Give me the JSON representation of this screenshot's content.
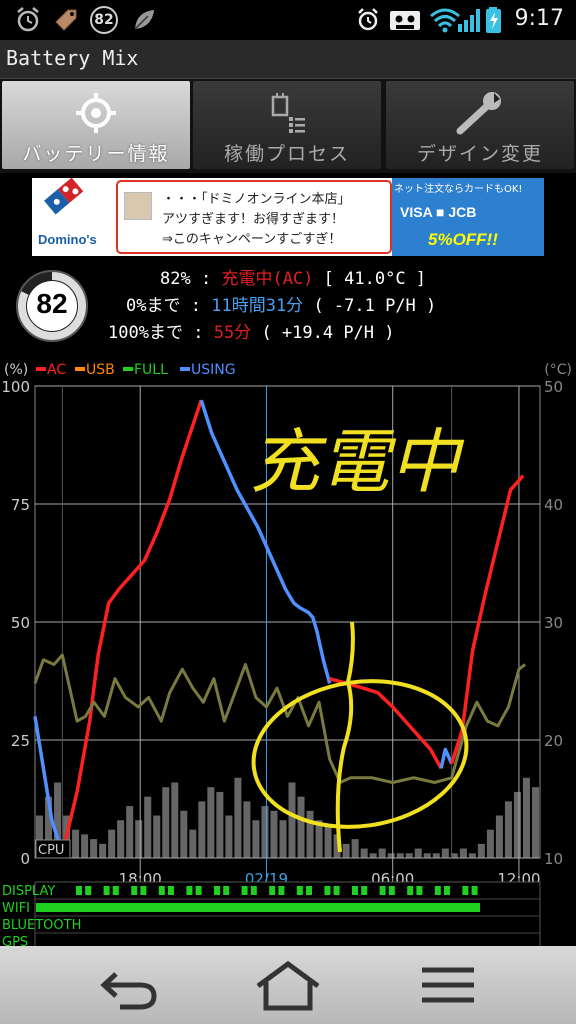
{
  "status_bar": {
    "time": "9:17",
    "battery_badge": "82",
    "icons_left": [
      "alarm-icon",
      "tag-icon",
      "battery-mix-badge-icon",
      "leaf-icon"
    ],
    "icons_right": [
      "alarm-icon",
      "cassette-icon",
      "wifi-icon",
      "signal-icon",
      "battery-charging-icon"
    ]
  },
  "app": {
    "title": "Battery Mix"
  },
  "tabs": [
    {
      "label": "バッテリー情報",
      "icon": "crosshair-icon",
      "selected": true
    },
    {
      "label": "稼働プロセス",
      "icon": "process-list-icon",
      "selected": false
    },
    {
      "label": "デザイン変更",
      "icon": "wrench-icon",
      "selected": false
    }
  ],
  "ad": {
    "brand": "Domino's",
    "line1": "・・・「ドミノオンライン本店」",
    "line2": "アツすぎます！お得すぎます！",
    "line3": "⇒このキャンペーンすごすぎ！",
    "right_top": "ネット注文ならカードもOK!",
    "right_cards": "VISA ■ JCB",
    "right_offer": "5%OFF!!"
  },
  "battery": {
    "level": "82",
    "row1": {
      "pct": "82%",
      "colon": ":",
      "status": "充電中(AC)",
      "temp": "[ 41.0°C ]"
    },
    "row2": {
      "label": "0%まで",
      "colon": ":",
      "time": "11時間31分",
      "rate": "( -7.1 P/H )"
    },
    "row3": {
      "label": "100%まで",
      "colon": ":",
      "time": "55分",
      "rate": "( +19.4 P/H )"
    }
  },
  "chart_data": {
    "type": "line",
    "left_axis_unit": "(%)",
    "right_axis_unit": "(°C)",
    "legend": [
      {
        "name": "AC",
        "color": "#ff2020"
      },
      {
        "name": "USB",
        "color": "#ff8800"
      },
      {
        "name": "FULL",
        "color": "#20d020"
      },
      {
        "name": "USING",
        "color": "#5090ff"
      }
    ],
    "yticks_left": [
      "100",
      "75",
      "50",
      "25",
      "0"
    ],
    "yticks_right": [
      "50",
      "40",
      "30",
      "20",
      "10"
    ],
    "ylim_left": [
      0,
      100
    ],
    "ylim_right": [
      10,
      50
    ],
    "xticks": [
      "18:00",
      "02/19",
      "06:00",
      "12:00"
    ],
    "cpu_label": "CPU",
    "x_hours_range": [
      13.0,
      37.0
    ],
    "series": [
      {
        "name": "USING",
        "color": "#5090ff",
        "x": [
          13.0,
          13.4,
          13.8,
          14.3
        ],
        "y": [
          30,
          19,
          8,
          1
        ]
      },
      {
        "name": "AC",
        "color": "#ff2020",
        "x": [
          14.3,
          15.0,
          15.6,
          16.0,
          16.5,
          17.0,
          17.6,
          18.2,
          18.8,
          19.4,
          20.0,
          20.6,
          20.9
        ],
        "y": [
          1,
          14,
          29,
          43,
          54,
          57,
          60,
          63,
          69,
          76,
          85,
          93,
          97
        ]
      },
      {
        "name": "USING",
        "color": "#5090ff",
        "x": [
          20.9,
          21.4,
          22.0,
          22.6,
          23.1,
          23.6,
          24.0,
          24.4,
          24.9,
          25.3,
          25.6,
          26.0,
          26.2,
          26.4,
          26.7,
          27.0
        ],
        "y": [
          97,
          90,
          84,
          78,
          74,
          70,
          66,
          62,
          57,
          54,
          53,
          52,
          51,
          48,
          42,
          37
        ]
      },
      {
        "name": "AC",
        "color": "#ff2020",
        "x": [
          27.0,
          27.8,
          28.6,
          29.3,
          30.0,
          30.6,
          31.2,
          31.8,
          32.3
        ],
        "y": [
          38,
          37,
          36,
          35,
          32,
          29,
          26,
          23,
          19
        ]
      },
      {
        "name": "USING",
        "color": "#5090ff",
        "x": [
          32.3,
          32.5,
          32.8
        ],
        "y": [
          19,
          23,
          20
        ]
      },
      {
        "name": "AC",
        "color": "#ff2020",
        "x": [
          32.8,
          33.3,
          33.8,
          34.4,
          35.0,
          35.6,
          36.2
        ],
        "y": [
          20,
          27,
          44,
          56,
          67,
          78,
          81
        ]
      },
      {
        "name": "Temperature",
        "color": "#7a7a40",
        "x": [
          13.0,
          13.4,
          13.9,
          14.3,
          14.6,
          15.0,
          15.4,
          15.8,
          16.3,
          16.8,
          17.3,
          17.9,
          18.4,
          19.0,
          19.4,
          20.0,
          20.5,
          21.0,
          21.5,
          22.0,
          22.5,
          23.0,
          23.5,
          24.0,
          24.5,
          25.0,
          25.5,
          26.0,
          26.5,
          27.0,
          27.5,
          28.0,
          29.0,
          30.0,
          31.0,
          32.0,
          32.8,
          33.5,
          34.0,
          34.5,
          35.0,
          35.5,
          36.0,
          36.3
        ],
        "y": [
          37,
          42,
          41,
          43,
          37,
          29,
          30,
          33,
          30,
          38,
          34,
          32,
          34,
          29,
          35,
          40,
          36,
          33,
          38,
          29,
          35,
          41,
          34,
          32,
          36,
          30,
          34,
          28,
          33,
          21,
          16,
          17,
          17,
          16,
          17,
          16,
          17,
          28,
          33,
          29,
          28,
          32,
          40,
          41
        ]
      }
    ],
    "cpu_bars": [
      9,
      13,
      16,
      9,
      6,
      5,
      4,
      3,
      6,
      8,
      11,
      8,
      13,
      9,
      15,
      16,
      10,
      6,
      12,
      15,
      14,
      9,
      17,
      12,
      8,
      11,
      10,
      8,
      16,
      13,
      10,
      8,
      7,
      5,
      3,
      4,
      2,
      1,
      2,
      1,
      1,
      1,
      2,
      1,
      1,
      2,
      1,
      2,
      1,
      3,
      6,
      9,
      12,
      14,
      17,
      15
    ]
  },
  "status_lines": {
    "labels": [
      "DISPLAY",
      "WIFI",
      "BLUETOOTH",
      "GPS"
    ]
  },
  "annotation": {
    "handwritten": "充電中"
  },
  "nav": {
    "buttons": [
      "back-icon",
      "home-icon",
      "menu-icon"
    ]
  }
}
